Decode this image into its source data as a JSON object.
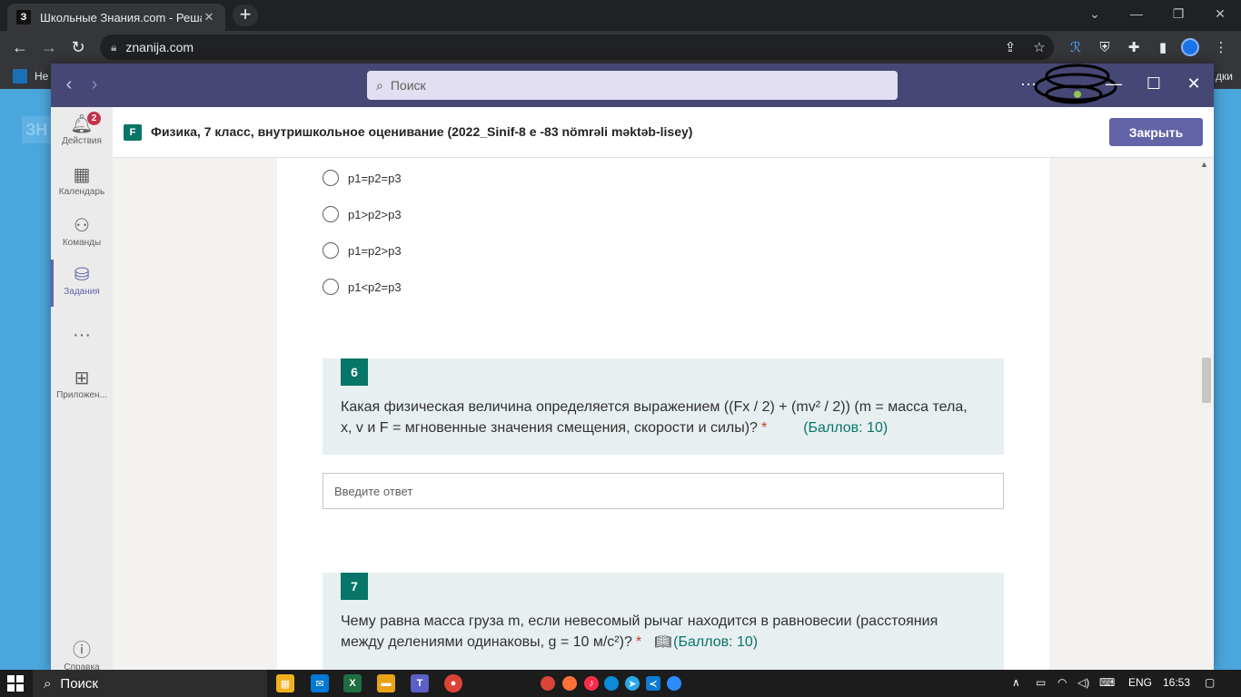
{
  "browser": {
    "tab_title": "Школьные Знания.com - Решае",
    "tab_favicon": "З",
    "url": "znanija.com",
    "bookmark_left": "Не",
    "bookmark_right": "дки"
  },
  "teams": {
    "search_placeholder": "Поиск",
    "more": "···",
    "rail": [
      {
        "label": "Действия",
        "icon": "bell-icon",
        "badge": "2"
      },
      {
        "label": "Календарь",
        "icon": "calendar-icon"
      },
      {
        "label": "Команды",
        "icon": "teams-icon"
      },
      {
        "label": "Задания",
        "icon": "backpack-icon"
      },
      {
        "label": "",
        "icon": "more-icon"
      },
      {
        "label": "Приложен...",
        "icon": "apps-icon"
      },
      {
        "label": "Справка",
        "icon": "help-icon"
      }
    ],
    "app_title": "Физика, 7 класс, внутришкольное оценивание (2022_Sinif-8 e -83 nömrəli məktəb-lisey)",
    "close_label": "Закрыть"
  },
  "form": {
    "options": [
      "p1=p2=p3",
      "p1>p2>p3",
      "p1=p2>p3",
      "p1<p2=p3"
    ],
    "q6": {
      "number": "6",
      "text": "Какая физическая величина определяется выражением ((Fx / 2) + (mv² / 2)) (m = масса тела, x, v и F = мгновенные значения смещения, скорости и силы)?",
      "required": "*",
      "points": "(Баллов: 10)"
    },
    "answer_placeholder": "Введите ответ",
    "q7": {
      "number": "7",
      "text": "Чему равна масса груза m, если невесомый рычаг находится в равновесии (расстояния между делениями одинаковы, g = 10 м/с²)?",
      "required": "*",
      "points": "(Баллов: 10)"
    }
  },
  "taskbar": {
    "search_label": "Поиск",
    "lang": "ENG",
    "time": "16:53"
  }
}
